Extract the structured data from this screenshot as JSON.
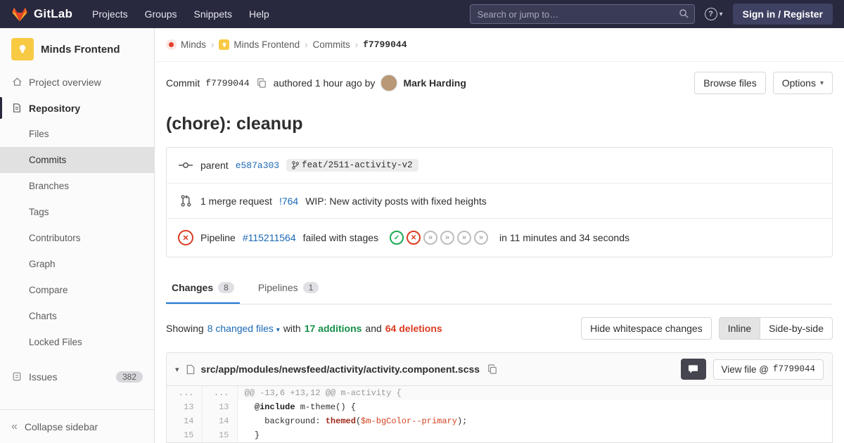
{
  "icons": {
    "caret_down": "▾",
    "breadcrumb_separator": "›",
    "collapse": "«",
    "help": "?",
    "check": "✓",
    "cross": "✕",
    "skipped": "»"
  },
  "navbar": {
    "brand": "GitLab",
    "links": [
      "Projects",
      "Groups",
      "Snippets",
      "Help"
    ],
    "search_placeholder": "Search or jump to…",
    "sign_in": "Sign in / Register"
  },
  "sidebar": {
    "project_name": "Minds Frontend",
    "overview_label": "Project overview",
    "repository_label": "Repository",
    "repo_items": [
      {
        "label": "Files",
        "active": false
      },
      {
        "label": "Commits",
        "active": true
      },
      {
        "label": "Branches",
        "active": false
      },
      {
        "label": "Tags",
        "active": false
      },
      {
        "label": "Contributors",
        "active": false
      },
      {
        "label": "Graph",
        "active": false
      },
      {
        "label": "Compare",
        "active": false
      },
      {
        "label": "Charts",
        "active": false
      },
      {
        "label": "Locked Files",
        "active": false
      }
    ],
    "issues_label": "Issues",
    "issues_count": "382",
    "collapse_label": "Collapse sidebar"
  },
  "breadcrumb": {
    "items": [
      {
        "label": "Minds",
        "icon": "minds",
        "current": false
      },
      {
        "label": "Minds Frontend",
        "icon": "bulb",
        "current": false
      },
      {
        "label": "Commits",
        "icon": "",
        "current": false
      },
      {
        "label": "f7799044",
        "icon": "",
        "current": true
      }
    ]
  },
  "commit": {
    "label": "Commit",
    "sha": "f7799044",
    "authored": "authored 1 hour ago by",
    "author": "Mark Harding",
    "browse_files": "Browse files",
    "options": "Options",
    "title": "(chore): cleanup",
    "parent_label": "parent",
    "parent_sha": "e587a303",
    "branch": "feat/2511-activity-v2",
    "mr_text": "1 merge request",
    "mr_ref": "!764",
    "mr_title": "WIP: New activity posts with fixed heights",
    "pipeline_label": "Pipeline",
    "pipeline_id": "#115211564",
    "pipeline_status": "failed with stages",
    "pipeline_stages": [
      "success",
      "failed",
      "skipped",
      "skipped",
      "skipped",
      "skipped"
    ],
    "pipeline_duration": "in 11 minutes and 34 seconds"
  },
  "tabs": [
    {
      "label": "Changes",
      "count": "8",
      "active": true
    },
    {
      "label": "Pipelines",
      "count": "1",
      "active": false
    }
  ],
  "diff_summary": {
    "showing": "Showing",
    "changed_files": "8 changed files",
    "with_text": "with",
    "additions": "17 additions",
    "and_text": "and",
    "deletions": "64 deletions",
    "hide_whitespace": "Hide whitespace changes",
    "inline": "Inline",
    "side_by_side": "Side-by-side"
  },
  "file_diff": {
    "path": "src/app/modules/newsfeed/activity/activity.component.scss",
    "view_file_prefix": "View file @",
    "view_file_sha": "f7799044",
    "lines": [
      {
        "type": "match",
        "old": "...",
        "new": "...",
        "segments": [
          {
            "t": "@@ -13,6 +13,12 @@ m-activity {",
            "c": ""
          }
        ]
      },
      {
        "type": "context",
        "old": "13",
        "new": "13",
        "segments": [
          {
            "t": "  ",
            "c": ""
          },
          {
            "t": "@include",
            "c": "k"
          },
          {
            "t": " m-theme() {",
            "c": ""
          }
        ]
      },
      {
        "type": "context",
        "old": "14",
        "new": "14",
        "segments": [
          {
            "t": "    background: ",
            "c": ""
          },
          {
            "t": "themed",
            "c": "fn"
          },
          {
            "t": "(",
            "c": ""
          },
          {
            "t": "$m-bgColor--primary",
            "c": "var"
          },
          {
            "t": ");",
            "c": ""
          }
        ]
      },
      {
        "type": "context",
        "old": "15",
        "new": "15",
        "segments": [
          {
            "t": "  }",
            "c": ""
          }
        ]
      }
    ]
  },
  "colors": {
    "link": "#1b69b6",
    "green": "#1aaa55",
    "red": "#db3b21",
    "navbar": "#28283e"
  }
}
